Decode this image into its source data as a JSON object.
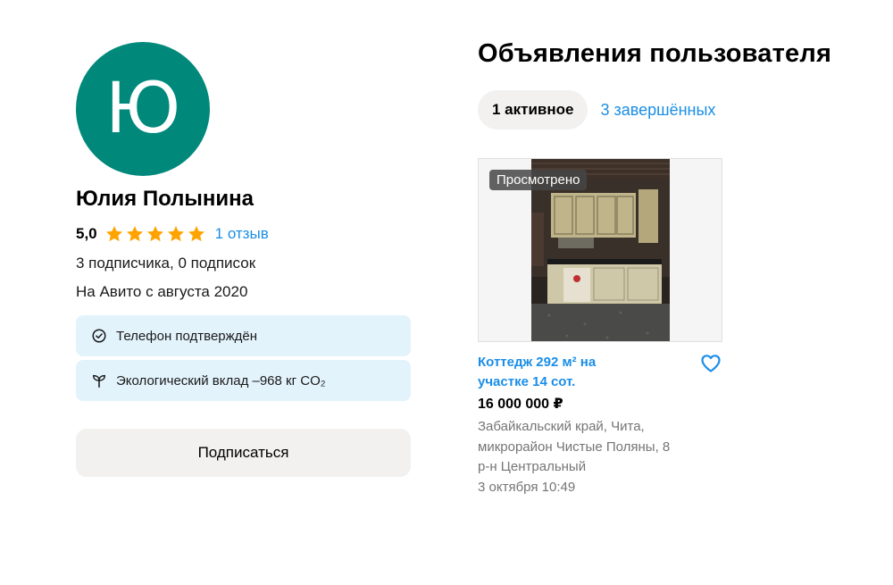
{
  "profile": {
    "avatar_letter": "Ю",
    "avatar_color": "#00897b",
    "name": "Юлия Полынина",
    "rating": "5,0",
    "stars": 5,
    "star_color": "#ffa300",
    "reviews_link": "1 отзыв",
    "followers": "3 подписчика, 0 подписок",
    "since": "На Авито с августа 2020",
    "badges": [
      {
        "icon": "check-circle-icon",
        "text": "Телефон подтверждён"
      },
      {
        "icon": "sprout-icon",
        "text": "Экологический вклад –968 кг CO₂"
      }
    ],
    "subscribe_label": "Подписаться"
  },
  "listings": {
    "title": "Объявления пользователя",
    "tabs": [
      {
        "label": "1 активное",
        "active": true
      },
      {
        "label": "3 завершённых",
        "active": false
      }
    ],
    "items": [
      {
        "viewed_label": "Просмотрено",
        "title": "Коттедж 292 м² на участке 14 сот.",
        "price": "16 000 000 ₽",
        "address_line1": "Забайкальский край, Чита,",
        "address_line2": "микрорайон Чистые Поляны, 8",
        "district": "р-н Центральный",
        "date": "3 октября 10:49"
      }
    ]
  },
  "colors": {
    "link": "#1a8ee6",
    "badge_bg": "#e3f3fc",
    "button_bg": "#f2f1f0"
  }
}
